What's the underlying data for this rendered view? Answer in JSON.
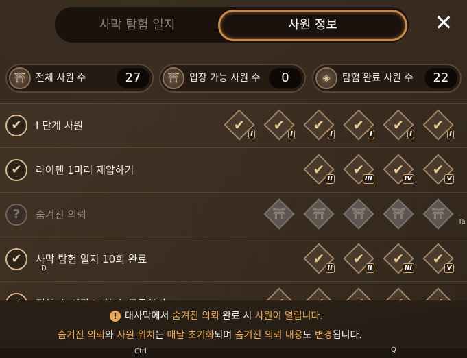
{
  "tabs": [
    {
      "label": "사막 탐험 일지",
      "active": false
    },
    {
      "label": "사원 정보",
      "active": true
    }
  ],
  "close_label": "✕",
  "stats": [
    {
      "label": "전체 사원 수",
      "value": "27"
    },
    {
      "label": "입장 가능 사원 수",
      "value": "0"
    },
    {
      "label": "탐험 완료 사원 수",
      "value": "22"
    }
  ],
  "rows": [
    {
      "title": "I  단계 사원",
      "checked": true,
      "badges": [
        "I",
        "I",
        "I",
        "I",
        "I",
        "I"
      ]
    },
    {
      "title": "라이텐 1마리 제압하기",
      "checked": true,
      "badges": [
        "II",
        "III",
        "IV",
        "V"
      ]
    },
    {
      "title": "숨겨진 의뢰",
      "checked": false,
      "badges": [
        "",
        "",
        "",
        "",
        ""
      ]
    },
    {
      "title": "사막 탐험 일지 10회 완료",
      "checked": true,
      "badges": [
        "II",
        "II",
        "III",
        "V"
      ]
    },
    {
      "title": "전체 수 시간 2 회 수 무궁하기",
      "checked": true,
      "badges": [
        "",
        "",
        "",
        "",
        ""
      ]
    }
  ],
  "notice": {
    "line1": [
      "대사막에서 ",
      "숨겨진 의뢰",
      " 완료 시 ",
      "사원이 열립니다."
    ],
    "line2": [
      "숨겨진 의뢰",
      "와 ",
      "사원 위치",
      "는 ",
      "매달 초기화",
      "되며 ",
      "숨겨진 의뢰 내용",
      "도 ",
      "변경",
      "됩니다."
    ]
  },
  "hints": {
    "d": "D",
    "ctrl": "Ctrl",
    "q": "Q",
    "tab": "Ta"
  },
  "colors": {
    "accent": "#e8a857",
    "tab_border": "#c98a48"
  }
}
